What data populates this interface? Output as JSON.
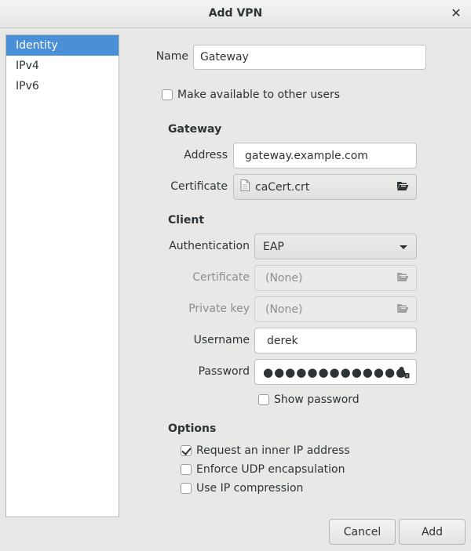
{
  "window": {
    "title": "Add VPN"
  },
  "sidebar": {
    "items": [
      {
        "label": "Identity",
        "selected": true
      },
      {
        "label": "IPv4",
        "selected": false
      },
      {
        "label": "IPv6",
        "selected": false
      }
    ]
  },
  "identity": {
    "name_label": "Name",
    "name_value": "Gateway",
    "share_label": "Make available to other users",
    "share_checked": false
  },
  "gateway": {
    "heading": "Gateway",
    "address_label": "Address",
    "address_value": "gateway.example.com",
    "certificate_label": "Certificate",
    "certificate_value": "caCert.crt"
  },
  "client": {
    "heading": "Client",
    "authentication_label": "Authentication",
    "authentication_value": "EAP",
    "certificate_label": "Certificate",
    "certificate_value": "(None)",
    "private_key_label": "Private key",
    "private_key_value": "(None)",
    "username_label": "Username",
    "username_value": "derek",
    "password_label": "Password",
    "password_mask": "●●●●●●●●●●●●●",
    "show_password_label": "Show password",
    "show_password_checked": false
  },
  "options": {
    "heading": "Options",
    "items": [
      {
        "label": "Request an inner IP address",
        "checked": true
      },
      {
        "label": "Enforce UDP encapsulation",
        "checked": false
      },
      {
        "label": "Use IP compression",
        "checked": false
      }
    ]
  },
  "footer": {
    "cancel_label": "Cancel",
    "add_label": "Add"
  }
}
